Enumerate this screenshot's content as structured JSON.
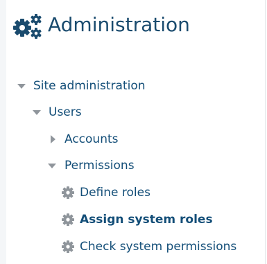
{
  "header": {
    "title": "Administration",
    "icon": "cogs-icon",
    "color": "#1a4b6e"
  },
  "nav": {
    "site_admin": {
      "label": "Site administration",
      "expanded": true
    },
    "users": {
      "label": "Users",
      "expanded": true
    },
    "accounts": {
      "label": "Accounts",
      "expanded": false
    },
    "permissions": {
      "label": "Permissions",
      "expanded": true
    },
    "define_roles": {
      "label": "Define roles",
      "icon": "gear-icon"
    },
    "assign_system_roles": {
      "label": "Assign system roles",
      "icon": "gear-icon",
      "active": true
    },
    "check_system_permissions": {
      "label": "Check system permissions",
      "icon": "gear-icon"
    }
  },
  "colors": {
    "link": "#134e78",
    "caret": "#8f959b",
    "gear": "#8f959b"
  }
}
